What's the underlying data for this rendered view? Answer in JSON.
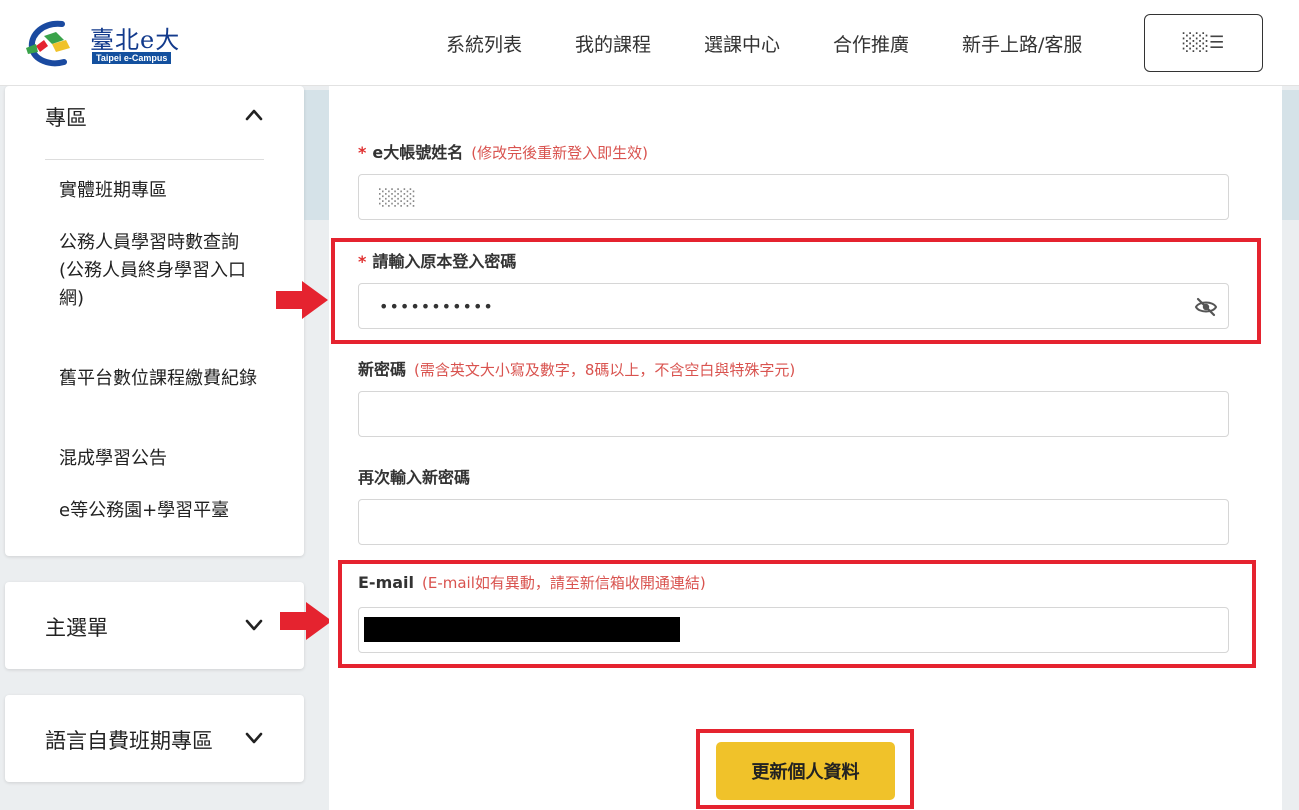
{
  "header": {
    "logo_text": "臺北e大",
    "logo_sub": "Taipei e-Campus",
    "nav": [
      "系統列表",
      "我的課程",
      "選課中心",
      "合作推廣",
      "新手上路/客服"
    ],
    "user_button": "░░☰"
  },
  "sidebar": {
    "panel1": {
      "title": "專區",
      "items": [
        "實體班期專區",
        "公務人員學習時數查詢",
        "(公務人員終身學習入口網)",
        "舊平台數位課程繳費紀錄",
        "混成學習公告",
        "e等公務園+學習平臺"
      ]
    },
    "panel2": {
      "title": "主選單"
    },
    "panel3": {
      "title": "語言自費班期專區"
    }
  },
  "form": {
    "name": {
      "required": "*",
      "label": "e大帳號姓名",
      "hint": "(修改完後重新登入即生效)",
      "value": "░░░"
    },
    "old_password": {
      "required": "*",
      "label": "請輸入原本登入密碼",
      "value": "•••••••••••"
    },
    "new_password": {
      "label": "新密碼",
      "hint": "(需含英文大小寫及數字，8碼以上，不含空白與特殊字元)",
      "value": ""
    },
    "confirm_password": {
      "label": "再次輸入新密碼",
      "value": ""
    },
    "email": {
      "label": "E-mail",
      "hint": "(E-mail如有異動，請至新信箱收開通連結)",
      "value": ""
    },
    "submit_label": "更新個人資料"
  },
  "colors": {
    "highlight": "#e5232f",
    "submit": "#f0c22a",
    "hint": "#d9534f",
    "required": "#e03030"
  }
}
